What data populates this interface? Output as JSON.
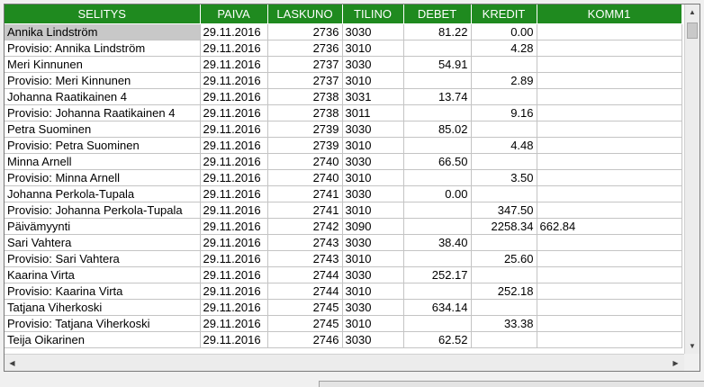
{
  "grid": {
    "columns": [
      "SELITYS",
      "PAIVA",
      "LASKUNO",
      "TILINO",
      "DEBET",
      "KREDIT",
      "KOMM1"
    ],
    "rows": [
      {
        "selitys": "Annika Lindström",
        "paiva": "29.11.2016",
        "laskuno": "2736",
        "tilino": "3030",
        "debet": "81.22",
        "kredit": "0.00",
        "komm1": ""
      },
      {
        "selitys": "Provisio: Annika Lindström",
        "paiva": "29.11.2016",
        "laskuno": "2736",
        "tilino": "3010",
        "debet": "",
        "kredit": "4.28",
        "komm1": ""
      },
      {
        "selitys": "Meri Kinnunen",
        "paiva": "29.11.2016",
        "laskuno": "2737",
        "tilino": "3030",
        "debet": "54.91",
        "kredit": "",
        "komm1": ""
      },
      {
        "selitys": "Provisio: Meri Kinnunen",
        "paiva": "29.11.2016",
        "laskuno": "2737",
        "tilino": "3010",
        "debet": "",
        "kredit": "2.89",
        "komm1": ""
      },
      {
        "selitys": "Johanna Raatikainen 4",
        "paiva": "29.11.2016",
        "laskuno": "2738",
        "tilino": "3031",
        "debet": "13.74",
        "kredit": "",
        "komm1": ""
      },
      {
        "selitys": "Provisio: Johanna Raatikainen 4",
        "paiva": "29.11.2016",
        "laskuno": "2738",
        "tilino": "3011",
        "debet": "",
        "kredit": "9.16",
        "komm1": ""
      },
      {
        "selitys": "Petra Suominen",
        "paiva": "29.11.2016",
        "laskuno": "2739",
        "tilino": "3030",
        "debet": "85.02",
        "kredit": "",
        "komm1": ""
      },
      {
        "selitys": "Provisio: Petra Suominen",
        "paiva": "29.11.2016",
        "laskuno": "2739",
        "tilino": "3010",
        "debet": "",
        "kredit": "4.48",
        "komm1": ""
      },
      {
        "selitys": "Minna Arnell",
        "paiva": "29.11.2016",
        "laskuno": "2740",
        "tilino": "3030",
        "debet": "66.50",
        "kredit": "",
        "komm1": ""
      },
      {
        "selitys": "Provisio: Minna Arnell",
        "paiva": "29.11.2016",
        "laskuno": "2740",
        "tilino": "3010",
        "debet": "",
        "kredit": "3.50",
        "komm1": ""
      },
      {
        "selitys": "Johanna Perkola-Tupala",
        "paiva": "29.11.2016",
        "laskuno": "2741",
        "tilino": "3030",
        "debet": "0.00",
        "kredit": "",
        "komm1": ""
      },
      {
        "selitys": "Provisio: Johanna Perkola-Tupala",
        "paiva": "29.11.2016",
        "laskuno": "2741",
        "tilino": "3010",
        "debet": "",
        "kredit": "347.50",
        "komm1": ""
      },
      {
        "selitys": "Päivämyynti",
        "paiva": "29.11.2016",
        "laskuno": "2742",
        "tilino": "3090",
        "debet": "",
        "kredit": "2258.34",
        "komm1": "662.84"
      },
      {
        "selitys": "Sari Vahtera",
        "paiva": "29.11.2016",
        "laskuno": "2743",
        "tilino": "3030",
        "debet": "38.40",
        "kredit": "",
        "komm1": ""
      },
      {
        "selitys": "Provisio: Sari Vahtera",
        "paiva": "29.11.2016",
        "laskuno": "2743",
        "tilino": "3010",
        "debet": "",
        "kredit": "25.60",
        "komm1": ""
      },
      {
        "selitys": "Kaarina Virta",
        "paiva": "29.11.2016",
        "laskuno": "2744",
        "tilino": "3030",
        "debet": "252.17",
        "kredit": "",
        "komm1": ""
      },
      {
        "selitys": "Provisio: Kaarina Virta",
        "paiva": "29.11.2016",
        "laskuno": "2744",
        "tilino": "3010",
        "debet": "",
        "kredit": "252.18",
        "komm1": ""
      },
      {
        "selitys": "Tatjana Viherkoski",
        "paiva": "29.11.2016",
        "laskuno": "2745",
        "tilino": "3030",
        "debet": "634.14",
        "kredit": "",
        "komm1": ""
      },
      {
        "selitys": "Provisio: Tatjana Viherkoski",
        "paiva": "29.11.2016",
        "laskuno": "2745",
        "tilino": "3010",
        "debet": "",
        "kredit": "33.38",
        "komm1": ""
      },
      {
        "selitys": "Teija Oikarinen",
        "paiva": "29.11.2016",
        "laskuno": "2746",
        "tilino": "3030",
        "debet": "62.52",
        "kredit": "",
        "komm1": ""
      }
    ],
    "selected_row": 0
  },
  "icons": {
    "scroll_up": "▲",
    "scroll_down": "▼",
    "scroll_left": "◀",
    "scroll_right": "▶"
  },
  "colors": {
    "header_bg": "#1f8a1f",
    "header_text": "#ffffff",
    "selected_cell": "#c8c8c8"
  }
}
